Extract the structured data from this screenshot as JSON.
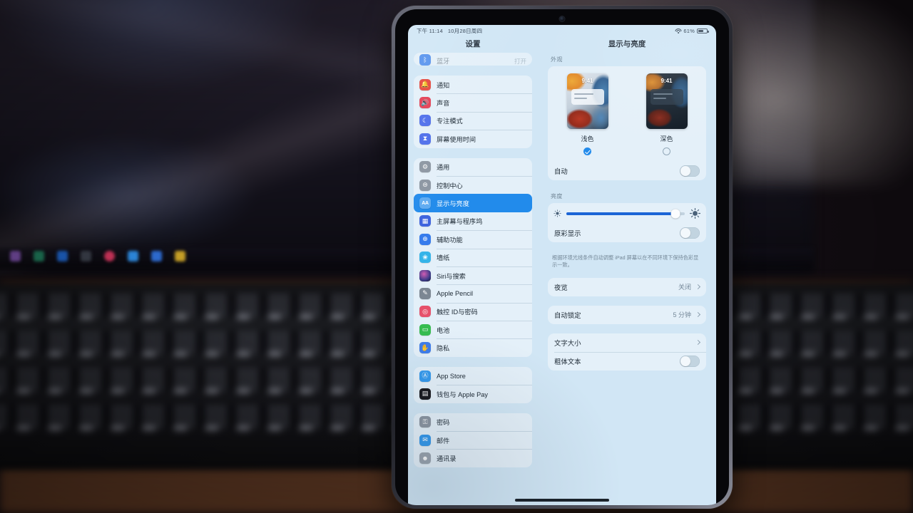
{
  "statusbar": {
    "time": "下午 11:14",
    "date": "10月28日周四",
    "wifi_icon": "wifi-icon",
    "battery_percent": "61%",
    "battery_icon": "battery-icon"
  },
  "header": {
    "sidebar_title": "设置",
    "detail_title": "显示与亮度"
  },
  "sidebar": {
    "scrolled_row": {
      "label": "蓝牙",
      "value": "打开",
      "icon": "bluetooth-icon",
      "color": "#2f7cf6"
    },
    "groups": [
      {
        "items": [
          {
            "label": "通知",
            "icon": "bell-icon",
            "color": "#f04438"
          },
          {
            "label": "声音",
            "icon": "speaker-icon",
            "color": "#ef3b52"
          },
          {
            "label": "专注模式",
            "icon": "moon-icon",
            "color": "#4a6ef5"
          },
          {
            "label": "屏幕使用时间",
            "icon": "hourglass-icon",
            "color": "#4a6ef5"
          }
        ]
      },
      {
        "items": [
          {
            "label": "通用",
            "icon": "gear-icon",
            "color": "#8b96a3"
          },
          {
            "label": "控制中心",
            "icon": "toggles-icon",
            "color": "#8b96a3"
          },
          {
            "label": "显示与亮度",
            "icon": "aa-icon",
            "color": "#2e7fd6",
            "selected": true
          },
          {
            "label": "主屏幕与程序坞",
            "icon": "grid-icon",
            "color": "#3a63e8"
          },
          {
            "label": "辅助功能",
            "icon": "accessibility-icon",
            "color": "#2f7cf6"
          },
          {
            "label": "墙纸",
            "icon": "flower-icon",
            "color": "#2bb6f0"
          },
          {
            "label": "Siri与搜索",
            "icon": "siri-icon",
            "color": "#2a2540"
          },
          {
            "label": "Apple Pencil",
            "icon": "pencil-icon",
            "color": "#7b8794"
          },
          {
            "label": "触控 ID与密码",
            "icon": "fingerprint-icon",
            "color": "#f04e6a"
          },
          {
            "label": "电池",
            "icon": "battery-green-icon",
            "color": "#2fbf4a"
          },
          {
            "label": "隐私",
            "icon": "hand-icon",
            "color": "#3a7ef5"
          }
        ]
      },
      {
        "items": [
          {
            "label": "App Store",
            "icon": "appstore-icon",
            "color": "#2f9bf5"
          },
          {
            "label": "钱包与 Apple Pay",
            "icon": "wallet-icon",
            "color": "#1b1b20"
          }
        ]
      },
      {
        "items": [
          {
            "label": "密码",
            "icon": "key-icon",
            "color": "#8b96a3"
          },
          {
            "label": "邮件",
            "icon": "mail-icon",
            "color": "#2f9bf5"
          },
          {
            "label": "通讯录",
            "icon": "contacts-icon",
            "color": "#9aa5b1"
          }
        ]
      }
    ]
  },
  "detail": {
    "appearance_header": "外观",
    "appearance": {
      "light": {
        "name": "浅色",
        "preview_time": "9:41",
        "selected": true
      },
      "dark": {
        "name": "深色",
        "preview_time": "9:41",
        "selected": false
      }
    },
    "auto_row": {
      "label": "自动",
      "toggle_on": false
    },
    "brightness_header": "亮度",
    "brightness": {
      "value": 92,
      "low_icon": "sun-small-icon",
      "high_icon": "sun-large-icon"
    },
    "true_tone": {
      "label": "原彩显示",
      "toggle_on": false
    },
    "true_tone_note": "根据环境光线条件自动调整 iPad 屏幕以在不同环境下保持色彩显示一致。",
    "night_shift": {
      "label": "夜览",
      "value": "关闭"
    },
    "auto_lock": {
      "label": "自动锁定",
      "value": "5 分钟"
    },
    "text_size": {
      "label": "文字大小",
      "value": ""
    },
    "bold_text": {
      "label": "粗体文本",
      "toggle_on": false
    }
  },
  "colors": {
    "accent": "#1a8cf5",
    "slider_fill": "#1566e0",
    "screen_bg": "#cfe6f7"
  }
}
